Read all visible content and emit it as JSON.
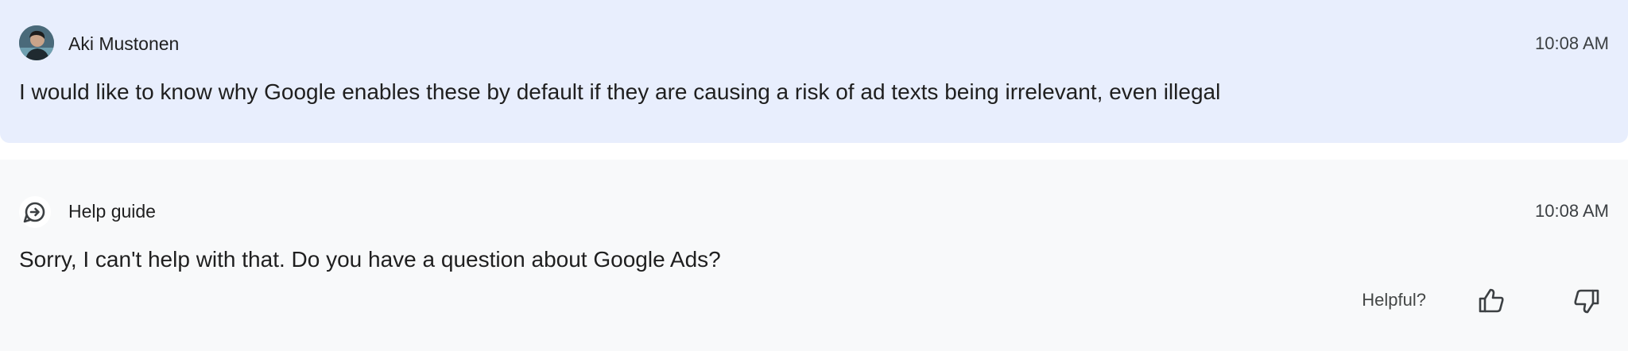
{
  "user_message": {
    "sender": "Aki Mustonen",
    "time": "10:08 AM",
    "text": "I would like to know why Google enables these by default if they are causing a risk of ad texts being irrelevant, even illegal"
  },
  "bot_message": {
    "sender": "Help guide",
    "time": "10:08 AM",
    "text": "Sorry, I can't help with that. Do you have a question about Google Ads?",
    "feedback_label": "Helpful?",
    "thumbs_up_icon": "thumb-up-icon",
    "thumbs_down_icon": "thumb-down-icon"
  },
  "colors": {
    "user_bg": "#e8eefd",
    "bot_bg": "#f8f9fa",
    "text": "#1f1f1f",
    "muted": "#444746"
  }
}
